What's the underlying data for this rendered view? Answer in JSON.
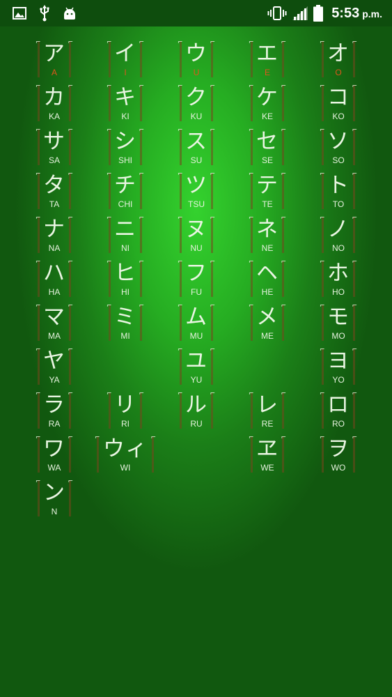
{
  "status_bar": {
    "left_icons": [
      "image-icon",
      "usb-icon",
      "android-icon"
    ],
    "right_icons": [
      "vibrate-icon",
      "signal-icon",
      "battery-icon"
    ],
    "time": "5:53",
    "ampm": "p.m."
  },
  "accent_color": "#e0561c",
  "text_color": "#e9f5e2",
  "kana_rows": [
    [
      {
        "kana": "ア",
        "romaji": "A",
        "accent": true
      },
      {
        "kana": "イ",
        "romaji": "I",
        "accent": true
      },
      {
        "kana": "ウ",
        "romaji": "U",
        "accent": true
      },
      {
        "kana": "エ",
        "romaji": "E",
        "accent": true
      },
      {
        "kana": "オ",
        "romaji": "O",
        "accent": true
      }
    ],
    [
      {
        "kana": "カ",
        "romaji": "KA"
      },
      {
        "kana": "キ",
        "romaji": "KI"
      },
      {
        "kana": "ク",
        "romaji": "KU"
      },
      {
        "kana": "ケ",
        "romaji": "KE"
      },
      {
        "kana": "コ",
        "romaji": "KO"
      }
    ],
    [
      {
        "kana": "サ",
        "romaji": "SA"
      },
      {
        "kana": "シ",
        "romaji": "SHI"
      },
      {
        "kana": "ス",
        "romaji": "SU"
      },
      {
        "kana": "セ",
        "romaji": "SE"
      },
      {
        "kana": "ソ",
        "romaji": "SO"
      }
    ],
    [
      {
        "kana": "タ",
        "romaji": "TA"
      },
      {
        "kana": "チ",
        "romaji": "CHI"
      },
      {
        "kana": "ツ",
        "romaji": "TSU"
      },
      {
        "kana": "テ",
        "romaji": "TE"
      },
      {
        "kana": "ト",
        "romaji": "TO"
      }
    ],
    [
      {
        "kana": "ナ",
        "romaji": "NA"
      },
      {
        "kana": "ニ",
        "romaji": "NI"
      },
      {
        "kana": "ヌ",
        "romaji": "NU"
      },
      {
        "kana": "ネ",
        "romaji": "NE"
      },
      {
        "kana": "ノ",
        "romaji": "NO"
      }
    ],
    [
      {
        "kana": "ハ",
        "romaji": "HA"
      },
      {
        "kana": "ヒ",
        "romaji": "HI"
      },
      {
        "kana": "フ",
        "romaji": "FU"
      },
      {
        "kana": "ヘ",
        "romaji": "HE"
      },
      {
        "kana": "ホ",
        "romaji": "HO"
      }
    ],
    [
      {
        "kana": "マ",
        "romaji": "MA"
      },
      {
        "kana": "ミ",
        "romaji": "MI"
      },
      {
        "kana": "ム",
        "romaji": "MU"
      },
      {
        "kana": "メ",
        "romaji": "ME"
      },
      {
        "kana": "モ",
        "romaji": "MO"
      }
    ],
    [
      {
        "kana": "ヤ",
        "romaji": "YA"
      },
      null,
      {
        "kana": "ユ",
        "romaji": "YU"
      },
      null,
      {
        "kana": "ヨ",
        "romaji": "YO"
      }
    ],
    [
      {
        "kana": "ラ",
        "romaji": "RA"
      },
      {
        "kana": "リ",
        "romaji": "RI"
      },
      {
        "kana": "ル",
        "romaji": "RU"
      },
      {
        "kana": "レ",
        "romaji": "RE"
      },
      {
        "kana": "ロ",
        "romaji": "RO"
      }
    ],
    [
      {
        "kana": "ワ",
        "romaji": "WA"
      },
      {
        "kana": "ウィ",
        "romaji": "WI",
        "wide": true
      },
      null,
      {
        "kana": "ヱ",
        "romaji": "WE"
      },
      {
        "kana": "ヲ",
        "romaji": "WO"
      }
    ],
    [
      {
        "kana": "ン",
        "romaji": "N"
      },
      null,
      null,
      null,
      null
    ]
  ]
}
